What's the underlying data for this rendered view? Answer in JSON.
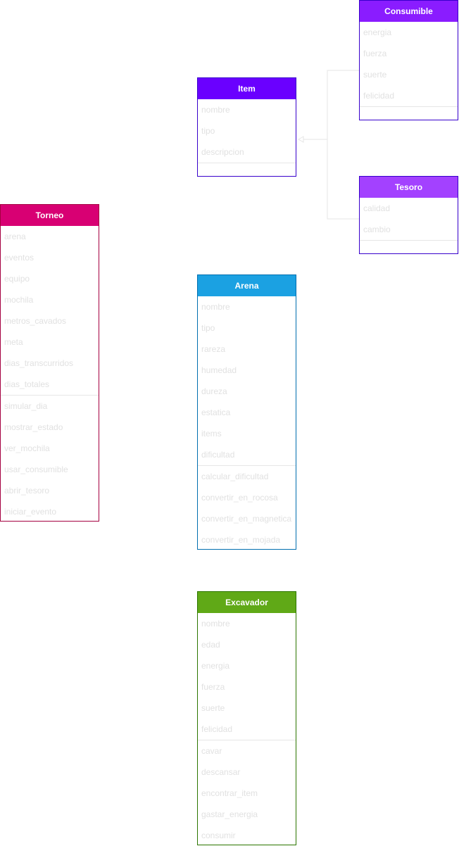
{
  "classes": {
    "consumible": {
      "name": "Consumible",
      "color": "#8a1cff",
      "attributes": [
        "energia",
        "fuerza",
        "suerte",
        "felicidad"
      ],
      "methods": []
    },
    "item": {
      "name": "Item",
      "color": "#6a00ff",
      "attributes": [
        "nombre",
        "tipo",
        "descripcion"
      ],
      "methods": []
    },
    "tesoro": {
      "name": "Tesoro",
      "color": "#a341ff",
      "attributes": [
        "calidad",
        "cambio"
      ],
      "methods": []
    },
    "torneo": {
      "name": "Torneo",
      "color": "#d80073",
      "border": "#a50040",
      "attributes": [
        "arena",
        "eventos",
        "equipo",
        "mochila",
        "metros_cavados",
        "meta",
        "dias_transcurridos",
        "dias_totales"
      ],
      "methods": [
        "simular_dia",
        "mostrar_estado",
        "ver_mochila",
        "usar_consumible",
        "abrir_tesoro",
        "iniciar_evento"
      ]
    },
    "arena": {
      "name": "Arena",
      "color": "#1ba1e2",
      "border": "#006eaf",
      "attributes": [
        "nombre",
        "tipo",
        "rareza",
        "humedad",
        "dureza",
        "estatica",
        "items",
        "dificultad"
      ],
      "methods": [
        "calcular_dificultad",
        "convertir_en_rocosa",
        "convertir_en_magnetica",
        "convertir_en_mojada"
      ]
    },
    "excavador": {
      "name": "Excavador",
      "color": "#60a917",
      "border": "#2d7600",
      "attributes": [
        "nombre",
        "edad",
        "energia",
        "fuerza",
        "suerte",
        "felicidad"
      ],
      "methods": [
        "cavar",
        "descansar",
        "encontrar_item",
        "gastar_energia",
        "consumir"
      ]
    }
  },
  "colors": {
    "line": "#e6e6e6",
    "text": "#e1e1e1",
    "purple_border": "#3700cc"
  }
}
